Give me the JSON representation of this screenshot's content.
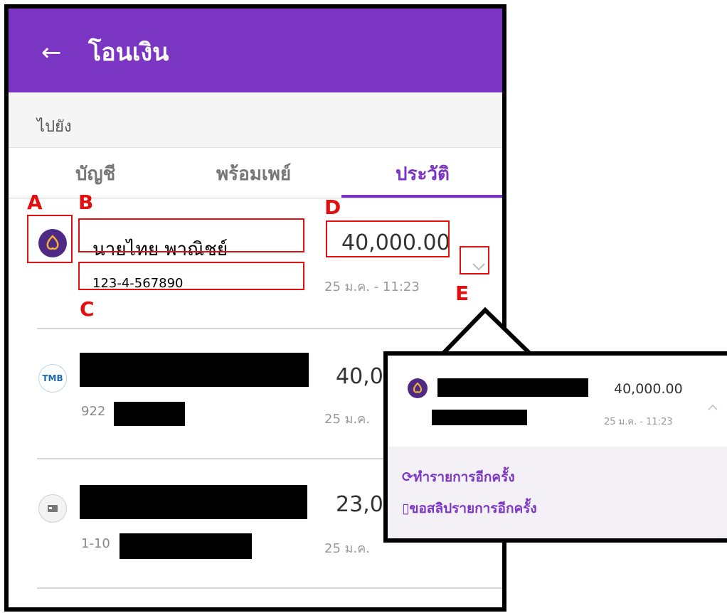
{
  "header": {
    "back_icon": "←",
    "title": "โอนเงิน"
  },
  "section_label": "ไปยัง",
  "tabs": {
    "account": "บัญชี",
    "promptpay": "พร้อมเพย์",
    "history": "ประวัติ"
  },
  "transactions": [
    {
      "bank_icon": "scb-icon",
      "name": "นายไทย พาณิชย์",
      "account": "123-4-567890",
      "amount": "40,000.00",
      "date": "25 ม.ค. - 11:23"
    },
    {
      "bank_icon": "tmb-icon",
      "bank_text": "TMB",
      "account_prefix": "922",
      "amount_partial": "40,0",
      "date_partial": "25 ม.ค."
    },
    {
      "bank_icon": "card-icon",
      "account_prefix": "1-10",
      "amount_partial": "23,0",
      "date_partial": "25 ม.ค."
    }
  ],
  "annotations": {
    "a": "A",
    "b": "B",
    "c": "C",
    "d": "D",
    "e": "E"
  },
  "popup": {
    "amount": "40,000.00",
    "date": "25 ม.ค. - 11:23",
    "actions": {
      "repeat_icon": "⟳",
      "repeat": "ทำรายการอีกครั้ง",
      "slip_icon": "▯",
      "slip": "ขอสลิปรายการอีกครั้ง"
    }
  },
  "colors": {
    "brand": "#7a36c2",
    "annotation": "#e01010",
    "scb": "#4e2a84"
  }
}
